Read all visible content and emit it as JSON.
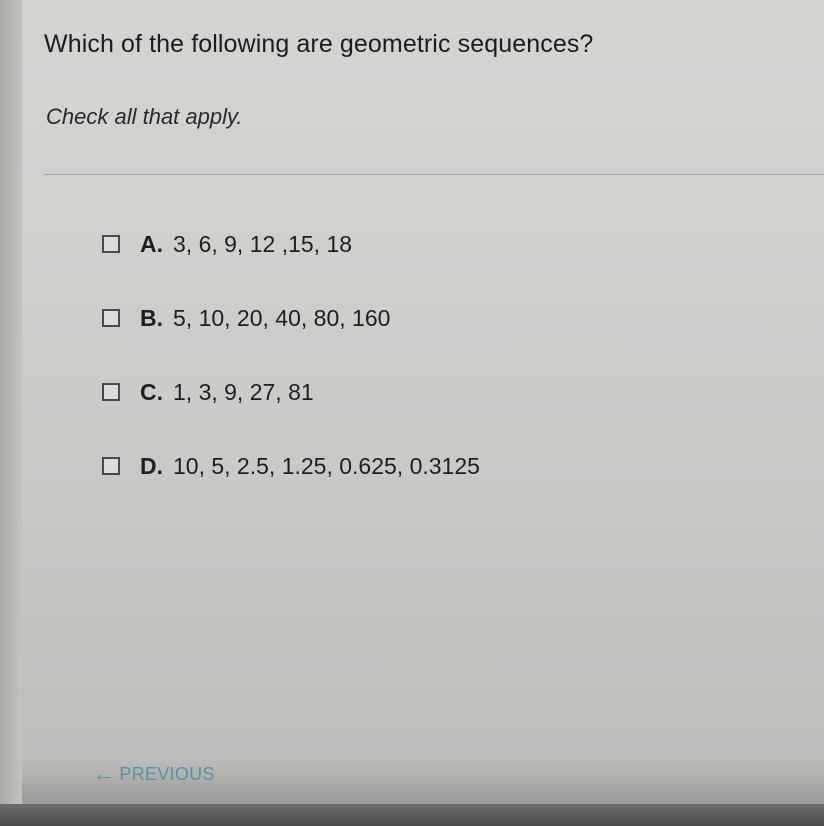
{
  "question": {
    "text": "Which of the following are geometric sequences?",
    "instruction": "Check all that apply."
  },
  "options": [
    {
      "letter": "A.",
      "sequence": "3, 6, 9, 12 ,15, 18",
      "checked": false
    },
    {
      "letter": "B.",
      "sequence": "5, 10, 20, 40, 80, 160",
      "checked": false
    },
    {
      "letter": "C.",
      "sequence": "1, 3, 9, 27, 81",
      "checked": false
    },
    {
      "letter": "D.",
      "sequence": "10, 5, 2.5, 1.25, 0.625, 0.3125",
      "checked": false
    }
  ],
  "navigation": {
    "previous_label": "PREVIOUS",
    "previous_icon": "left-arrow-icon",
    "previous_color": "#5e8ea6"
  }
}
